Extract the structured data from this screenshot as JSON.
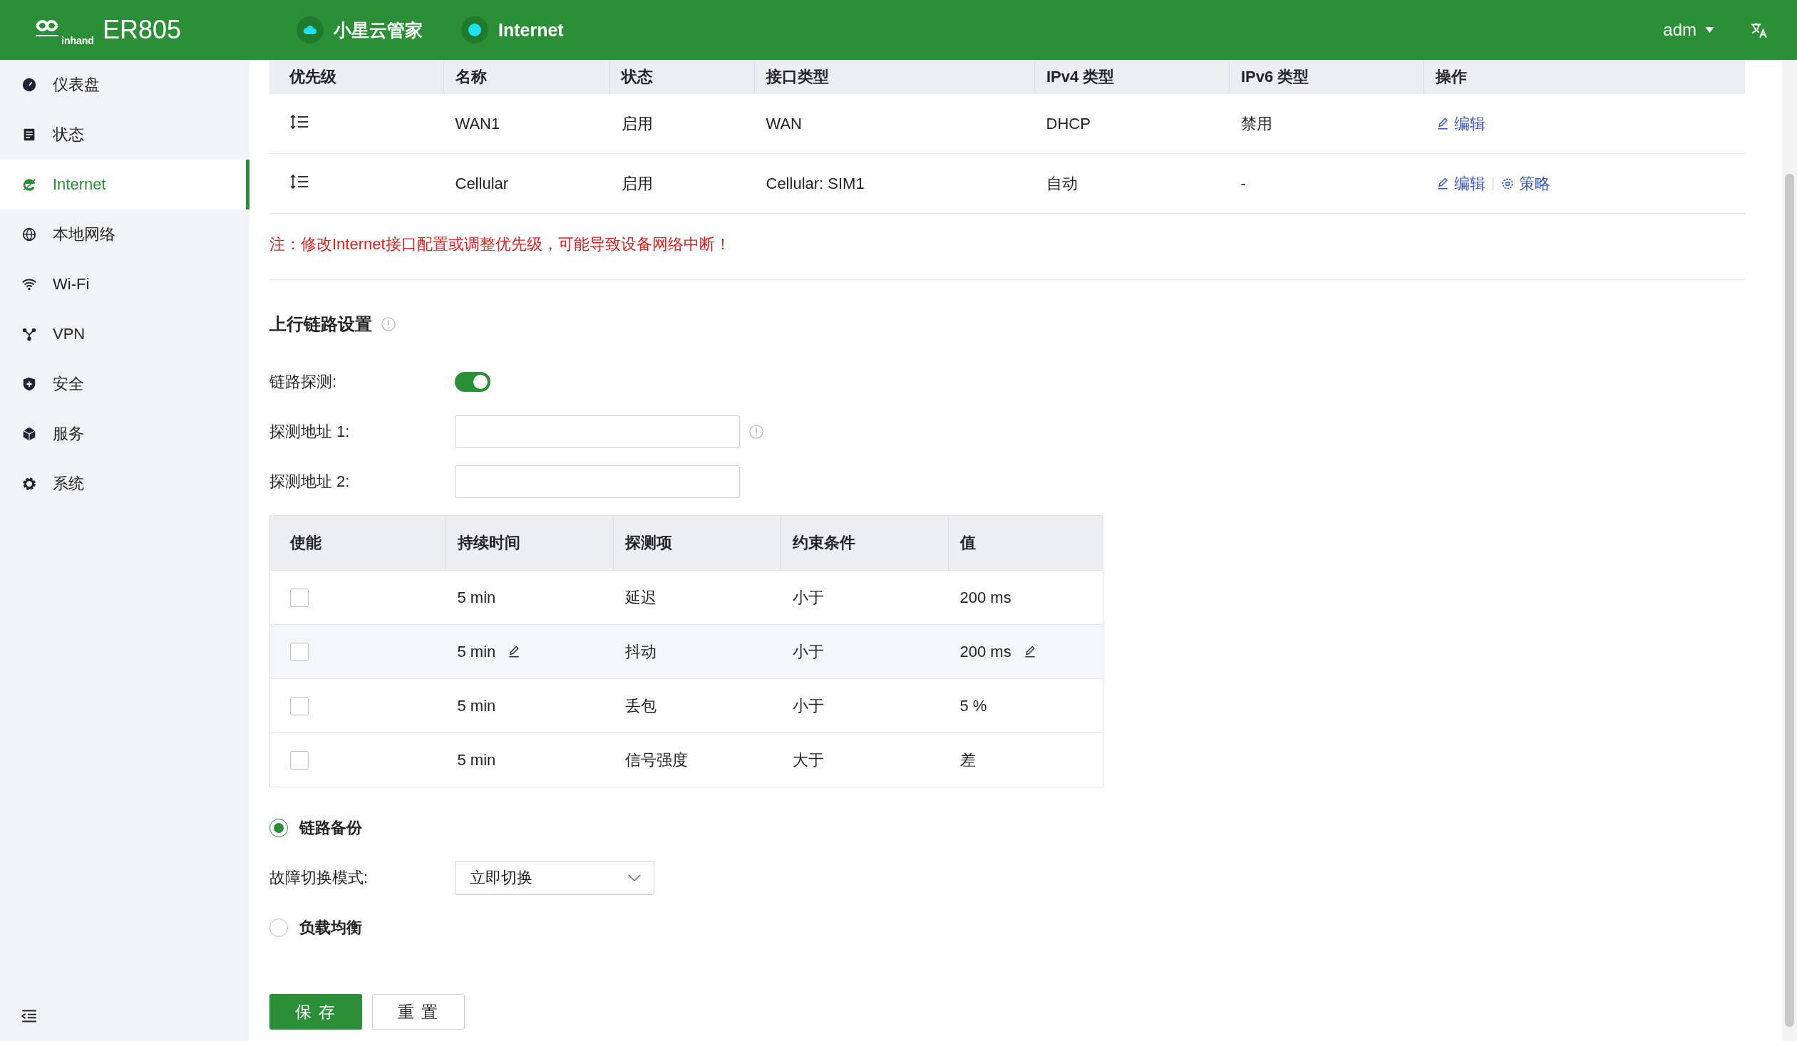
{
  "header": {
    "model": "ER805",
    "brand": "inhand",
    "cloud": {
      "label": "小星云管家"
    },
    "status": {
      "label": "Internet"
    },
    "user": "adm"
  },
  "sidebar": {
    "items": [
      {
        "label": "仪表盘",
        "kind": "dashboard",
        "selected": false
      },
      {
        "label": "状态",
        "kind": "status",
        "selected": false
      },
      {
        "label": "Internet",
        "kind": "internet",
        "selected": true
      },
      {
        "label": "本地网络",
        "kind": "lan",
        "selected": false
      },
      {
        "label": "Wi-Fi",
        "kind": "wifi",
        "selected": false
      },
      {
        "label": "VPN",
        "kind": "vpn",
        "selected": false
      },
      {
        "label": "安全",
        "kind": "security",
        "selected": false
      },
      {
        "label": "服务",
        "kind": "service",
        "selected": false
      },
      {
        "label": "系统",
        "kind": "system",
        "selected": false
      }
    ]
  },
  "interfaces": {
    "columns": [
      "优先级",
      "名称",
      "状态",
      "接口类型",
      "IPv4 类型",
      "IPv6 类型",
      "操作"
    ],
    "rows": [
      {
        "name": "WAN1",
        "state": "启用",
        "type": "WAN",
        "ipv4": "DHCP",
        "ipv6": "禁用",
        "actions": [
          {
            "kind": "edit",
            "label": "编辑"
          }
        ]
      },
      {
        "name": "Cellular",
        "state": "启用",
        "type": "Cellular: SIM1",
        "ipv4": "自动",
        "ipv6": "-",
        "actions": [
          {
            "kind": "edit",
            "label": "编辑"
          },
          {
            "kind": "policy",
            "label": "策略"
          }
        ]
      }
    ],
    "note": "注：修改Internet接口配置或调整优先级，可能导致设备网络中断！"
  },
  "uplink": {
    "title": "上行链路设置",
    "detection": {
      "label": "链路探测:",
      "on": true
    },
    "addresses": [
      {
        "label": "探测地址 1:",
        "info": true
      },
      {
        "label": "探测地址 2:",
        "info": false
      }
    ],
    "rules": {
      "columns": [
        "使能",
        "持续时间",
        "探测项",
        "约束条件",
        "值"
      ],
      "rows": [
        {
          "checked": false,
          "duration": "5 min",
          "item": "延迟",
          "condition": "小于",
          "value": "200 ms",
          "editable": false
        },
        {
          "checked": false,
          "duration": "5 min",
          "item": "抖动",
          "condition": "小于",
          "value": "200 ms",
          "editable": true
        },
        {
          "checked": false,
          "duration": "5 min",
          "item": "丢包",
          "condition": "小于",
          "value": "5 %",
          "editable": false
        },
        {
          "checked": false,
          "duration": "5 min",
          "item": "信号强度",
          "condition": "大于",
          "value": "差",
          "editable": false
        }
      ]
    },
    "modes": [
      {
        "label": "链路备份",
        "selected": true
      },
      {
        "label": "负载均衡",
        "selected": false
      }
    ],
    "failover": {
      "label": "故障切换模式:",
      "value": "立即切换"
    }
  },
  "buttons": [
    {
      "kind": "primary",
      "label": "保 存"
    },
    {
      "kind": "default",
      "label": "重 置"
    }
  ]
}
